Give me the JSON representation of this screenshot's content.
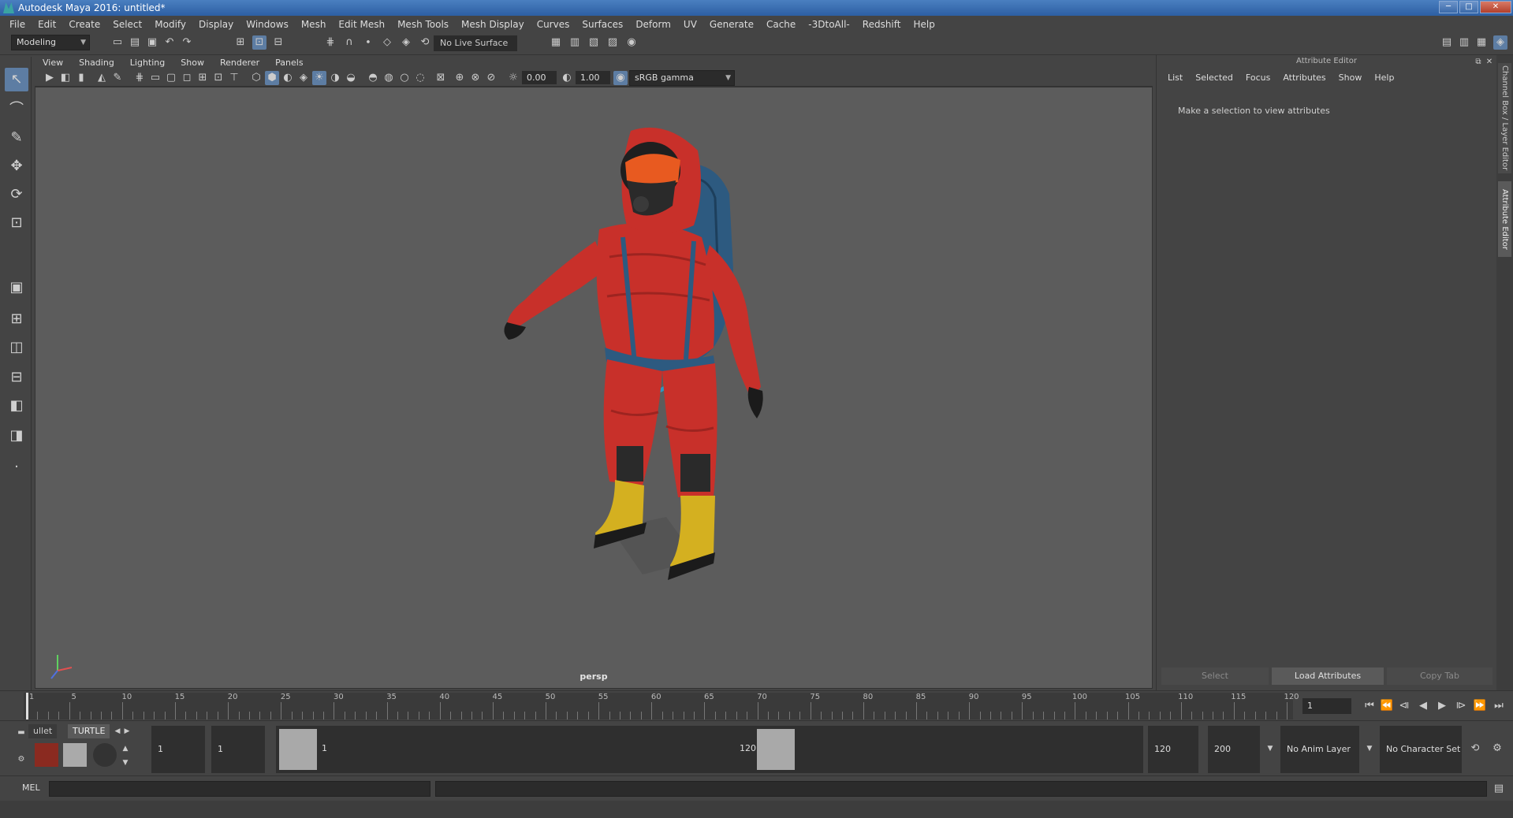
{
  "window": {
    "title": "Autodesk Maya 2016: untitled*"
  },
  "menubar": [
    "File",
    "Edit",
    "Create",
    "Select",
    "Modify",
    "Display",
    "Windows",
    "Mesh",
    "Edit Mesh",
    "Mesh Tools",
    "Mesh Display",
    "Curves",
    "Surfaces",
    "Deform",
    "UV",
    "Generate",
    "Cache",
    "-3DtoAll-",
    "Redshift",
    "Help"
  ],
  "shelfbar": {
    "mode": "Modeling",
    "live_surface": "No Live Surface"
  },
  "viewport": {
    "menu": [
      "View",
      "Shading",
      "Lighting",
      "Show",
      "Renderer",
      "Panels"
    ],
    "exposure": "0.00",
    "gamma": "1.00",
    "color_space": "sRGB gamma",
    "camera_label": "persp"
  },
  "attribute_editor": {
    "title": "Attribute Editor",
    "menu": [
      "List",
      "Selected",
      "Focus",
      "Attributes",
      "Show",
      "Help"
    ],
    "message": "Make a selection to view attributes",
    "buttons": {
      "select": "Select",
      "load": "Load Attributes",
      "copy": "Copy Tab"
    }
  },
  "side_tabs": {
    "channel_box": "Channel Box / Layer Editor",
    "attribute_editor": "Attribute Editor"
  },
  "timeline": {
    "ticks": [
      "1",
      "5",
      "10",
      "15",
      "20",
      "25",
      "30",
      "35",
      "40",
      "45",
      "50",
      "55",
      "60",
      "65",
      "70",
      "75",
      "80",
      "85",
      "90",
      "95",
      "100",
      "105",
      "110",
      "115",
      "120"
    ],
    "current_frame": "1"
  },
  "range": {
    "shelf_tabs": [
      "ullet",
      "TURTLE"
    ],
    "start_field": "1",
    "playback_start": "1",
    "slider_start": "1",
    "slider_end": "120",
    "playback_end": "120",
    "end_field": "200",
    "anim_layer": "No Anim Layer",
    "character_set": "No Character Set"
  },
  "command_line": {
    "label": "MEL"
  },
  "colors": {
    "suit": "#c8302a",
    "backpack": "#2d5a80",
    "boots": "#d4b020",
    "selection": "#5d7da3"
  }
}
